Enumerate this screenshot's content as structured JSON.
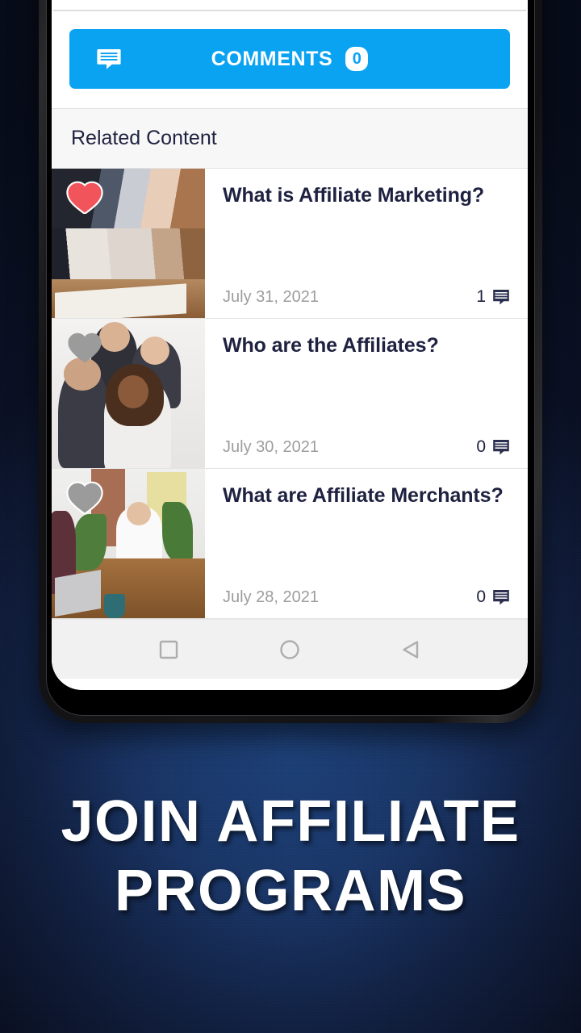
{
  "colors": {
    "accent_blue": "#09a3f2",
    "backdrop_blue": "#1a3666",
    "text_dark": "#1e2240",
    "text_muted": "#9d9d9d",
    "heart_liked": "#f2545b",
    "heart_unliked": "#9b9b9b"
  },
  "comments_button": {
    "icon": "comment-bubble-icon",
    "label": "COMMENTS",
    "count": "0"
  },
  "related": {
    "header": "Related Content",
    "items": [
      {
        "title": "What is Affiliate Marketing?",
        "date": "July 31, 2021",
        "comment_count": "1",
        "liked": true,
        "heart_icon": "heart-icon",
        "comment_icon": "comment-bubble-icon"
      },
      {
        "title": "Who are the Affiliates?",
        "date": "July 30, 2021",
        "comment_count": "0",
        "liked": false,
        "heart_icon": "heart-icon",
        "comment_icon": "comment-bubble-icon"
      },
      {
        "title": "What are Affiliate Merchants?",
        "date": "July 28, 2021",
        "comment_count": "0",
        "liked": false,
        "heart_icon": "heart-icon",
        "comment_icon": "comment-bubble-icon"
      }
    ]
  },
  "nav_bar": {
    "recents": "square-icon",
    "home": "circle-icon",
    "back": "triangle-left-icon"
  },
  "caption": {
    "line1": "JOIN AFFILIATE",
    "line2": "PROGRAMS"
  }
}
